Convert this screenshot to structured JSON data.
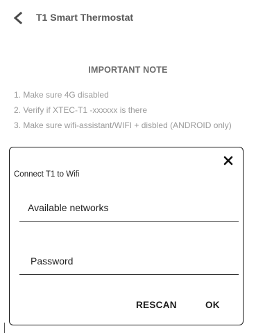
{
  "header": {
    "back_icon": "chevron-left-icon",
    "title": "T1 Smart Thermostat"
  },
  "note": {
    "heading": "IMPORTANT NOTE",
    "items": [
      "1. Make sure 4G disabled",
      "2. Verify if XTEC-T1 -xxxxxx is there",
      "3. Make sure wifi-assistant/WIFI + disbled (ANDROID only)"
    ]
  },
  "dialog": {
    "title": "Connect T1 to Wifi",
    "close_icon": "close-icon",
    "networks_placeholder": "Available networks",
    "password_placeholder": "Password",
    "rescan_label": "RESCAN",
    "ok_label": "OK"
  }
}
